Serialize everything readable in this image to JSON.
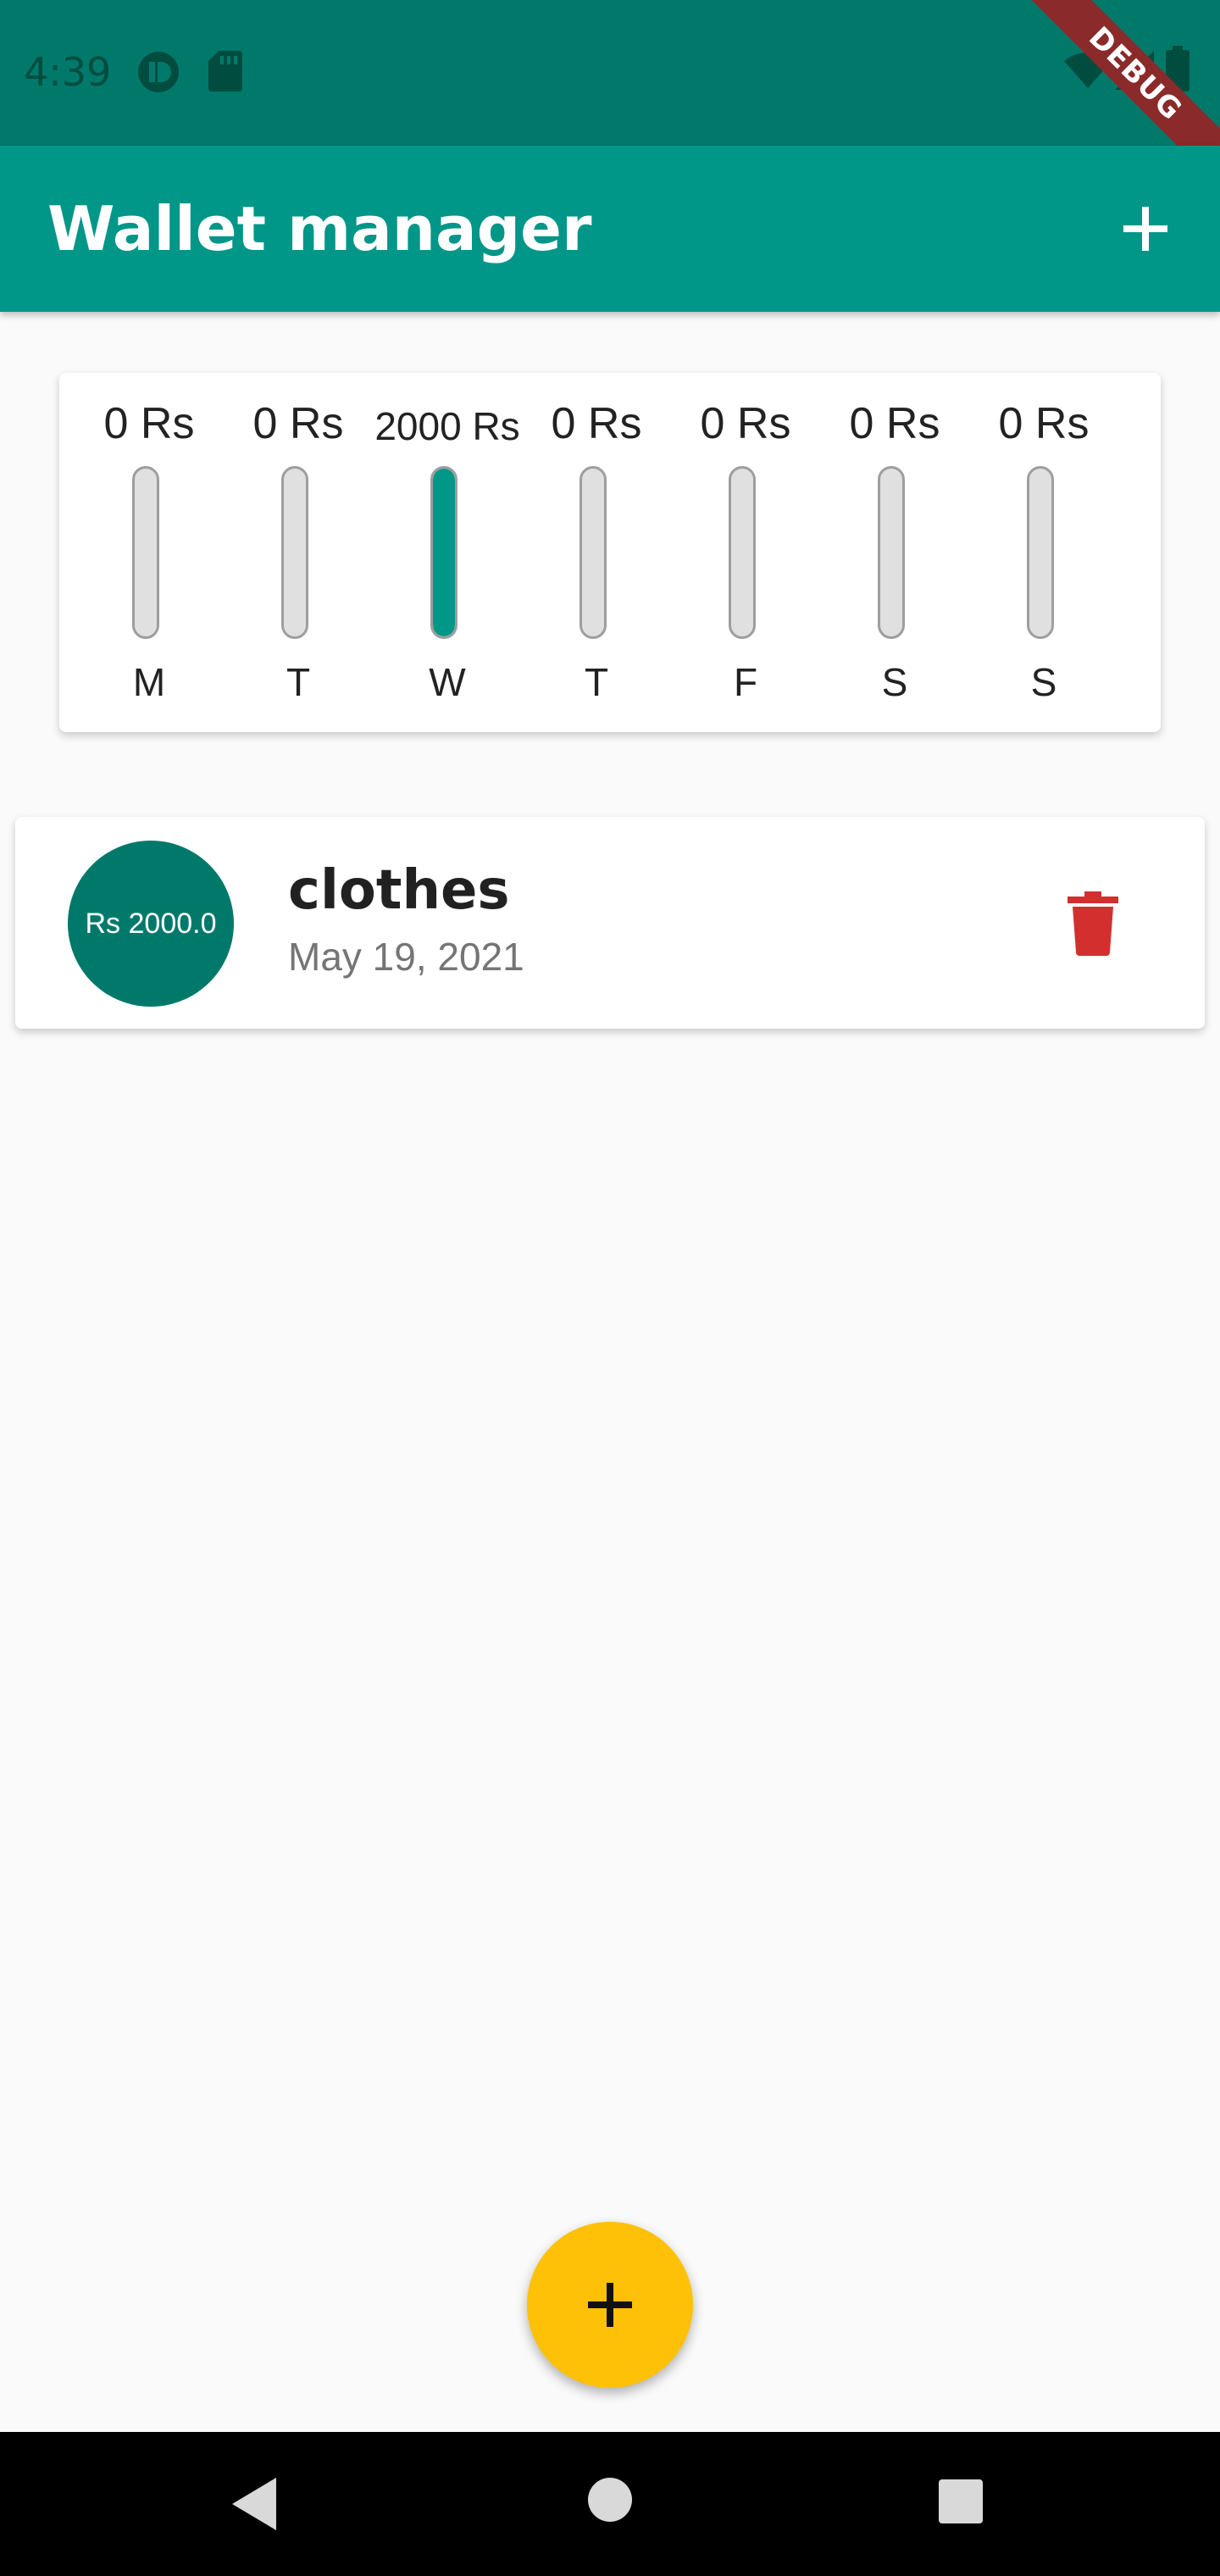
{
  "status_bar": {
    "time": "4:39",
    "icons": [
      "app-notification-icon",
      "sd-card-icon",
      "wifi-icon",
      "signal-icon",
      "battery-icon"
    ],
    "debug_banner": "DEBUG"
  },
  "app_bar": {
    "title": "Wallet manager",
    "action_icon": "add-icon"
  },
  "chart_data": {
    "type": "bar",
    "categories": [
      "M",
      "T",
      "W",
      "T",
      "F",
      "S",
      "S"
    ],
    "values": [
      0,
      0,
      2000,
      0,
      0,
      0,
      0
    ],
    "labels": [
      "0 Rs",
      "0 Rs",
      "2000 Rs",
      "0 Rs",
      "0 Rs",
      "0 Rs",
      "0 Rs"
    ],
    "fill_fraction": [
      0,
      0,
      1,
      0,
      0,
      0,
      0
    ],
    "bar_color": "#009688",
    "track_color": "#e0e0e0"
  },
  "transactions": [
    {
      "amount_label": "Rs 2000.0",
      "title": "clothes",
      "date": "May 19, 2021",
      "action_icon": "delete-icon"
    }
  ],
  "fab": {
    "icon": "add-icon",
    "color": "#ffc107"
  },
  "nav_bar": {
    "icons": [
      "back-icon",
      "home-icon",
      "recents-icon"
    ]
  },
  "colors": {
    "primary": "#009688",
    "primary_dark": "#00796b",
    "delete": "#d32f2f"
  }
}
